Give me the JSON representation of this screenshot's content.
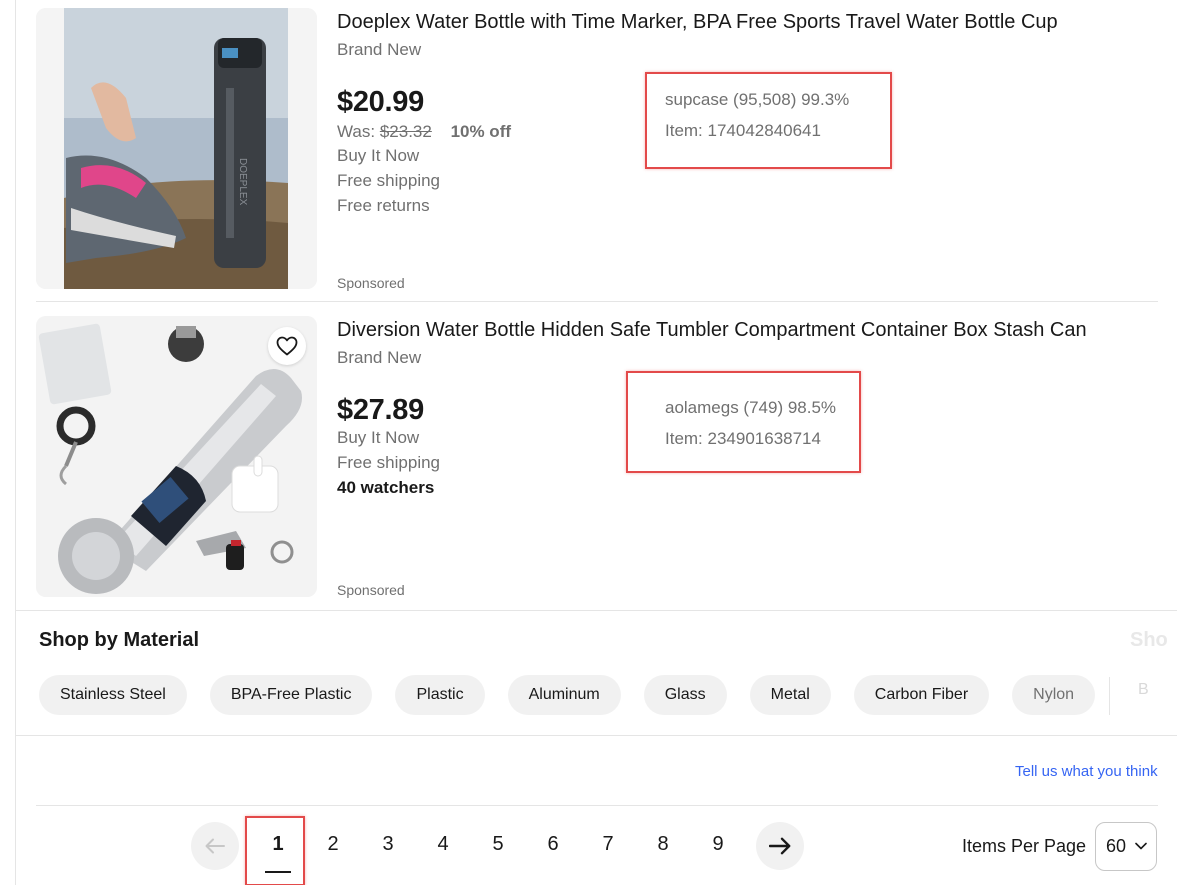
{
  "listings": [
    {
      "title": "Doeplex Water Bottle with Time Marker, BPA Free Sports Travel Water Bottle Cup",
      "condition": "Brand New",
      "price": "$20.99",
      "was_label": "Was:",
      "was_price": "$23.32",
      "discount": "10% off",
      "buy_format": "Buy It Now",
      "shipping": "Free shipping",
      "returns": "Free returns",
      "seller": "supcase (95,508) 99.3%",
      "item_number": "Item: 174042840641",
      "sponsored": "Sponsored",
      "bottle_brand_mark": "DOEPLEX"
    },
    {
      "title": "Diversion Water Bottle Hidden Safe Tumbler Compartment Container Box Stash Can",
      "condition": "Brand New",
      "price": "$27.89",
      "buy_format": "Buy It Now",
      "shipping": "Free shipping",
      "watchers": "40 watchers",
      "seller": "aolamegs (749) 98.5%",
      "item_number": "Item: 234901638714",
      "sponsored": "Sponsored",
      "heart_icon": "heart-icon"
    }
  ],
  "shop_by": {
    "title": "Shop by Material",
    "ghost_title": "Sho",
    "chips": [
      "Stainless Steel",
      "BPA-Free Plastic",
      "Plastic",
      "Aluminum",
      "Glass",
      "Metal",
      "Carbon Fiber",
      "Nylon"
    ],
    "ghost_chip": "B"
  },
  "feedback_link": "Tell us what you think",
  "pagination": {
    "pages": [
      "1",
      "2",
      "3",
      "4",
      "5",
      "6",
      "7",
      "8",
      "9"
    ],
    "current_page": "1",
    "prev_icon": "arrow-left-icon",
    "next_icon": "arrow-right-icon"
  },
  "items_per_page": {
    "label": "Items Per Page",
    "value": "60"
  },
  "colors": {
    "highlight_box": "#e34a4a",
    "link": "#3665f3",
    "muted_text": "#707070",
    "chip_bg": "#f1f1f1"
  }
}
